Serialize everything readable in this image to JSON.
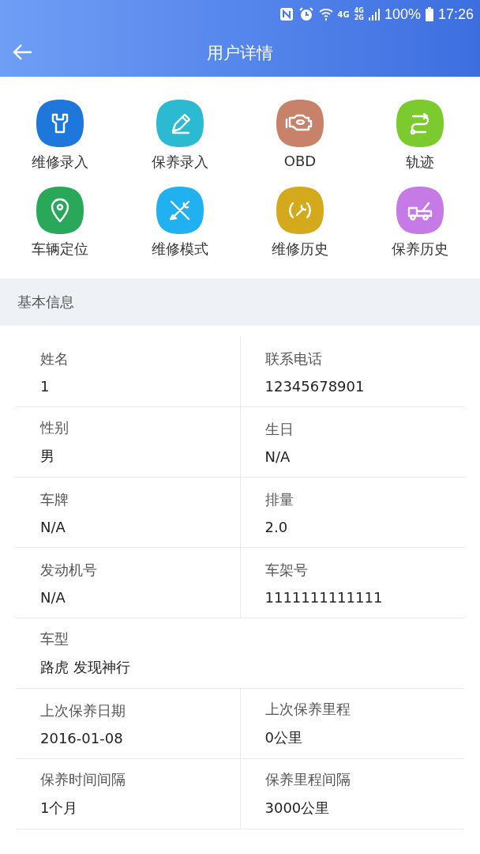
{
  "status_bar": {
    "network_1": "4G",
    "network_2a": "4G",
    "network_2b": "2G",
    "battery": "100%",
    "time": "17:26"
  },
  "header": {
    "title": "用户详情"
  },
  "shortcuts": [
    {
      "label": "维修录入",
      "color": "#1e78dc"
    },
    {
      "label": "保养录入",
      "color": "#2bbad2"
    },
    {
      "label": "OBD",
      "color": "#c9826a"
    },
    {
      "label": "轨迹",
      "color": "#7ccb2e"
    },
    {
      "label": "车辆定位",
      "color": "#2aa85a"
    },
    {
      "label": "维修模式",
      "color": "#21b0f0"
    },
    {
      "label": "维修历史",
      "color": "#d4aa1c"
    },
    {
      "label": "保养历史",
      "color": "#c57ae6"
    }
  ],
  "section": {
    "title": "基本信息"
  },
  "rows": [
    {
      "cells": [
        {
          "label": "姓名",
          "value": "1"
        },
        {
          "label": "联系电话",
          "value": "12345678901"
        }
      ]
    },
    {
      "cells": [
        {
          "label": "性别",
          "value": "男"
        },
        {
          "label": "生日",
          "value": "N/A"
        }
      ]
    },
    {
      "cells": [
        {
          "label": "车牌",
          "value": "N/A"
        },
        {
          "label": "排量",
          "value": "2.0"
        }
      ]
    },
    {
      "cells": [
        {
          "label": "发动机号",
          "value": "N/A"
        },
        {
          "label": "车架号",
          "value": "1111111111111"
        }
      ]
    },
    {
      "cells": [
        {
          "label": "车型",
          "value": "路虎 发现神行"
        }
      ]
    },
    {
      "cells": [
        {
          "label": "上次保养日期",
          "value": "2016-01-08"
        },
        {
          "label": "上次保养里程",
          "value": "0公里"
        }
      ]
    },
    {
      "cells": [
        {
          "label": "保养时间间隔",
          "value": "1个月"
        },
        {
          "label": "保养里程间隔",
          "value": "3000公里"
        }
      ]
    }
  ]
}
